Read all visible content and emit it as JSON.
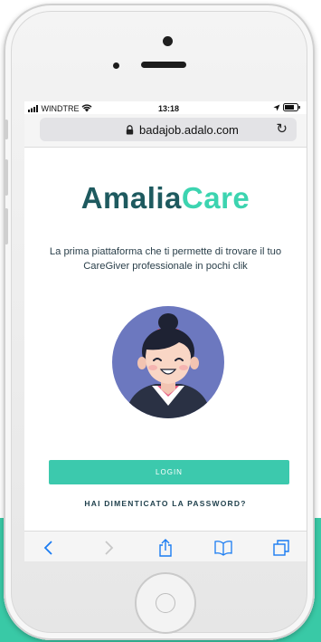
{
  "status_bar": {
    "carrier": "WINDTRE",
    "time": "13:18"
  },
  "browser": {
    "url": "badajob.adalo.com"
  },
  "app": {
    "brand_part1": "Amalia",
    "brand_part2": "Care",
    "tagline": "La prima piattaforma che ti permette di trovare il tuo CareGiver professionale in pochi clik",
    "login_label": "LOGIN",
    "forgot_password_label": "HAI DIMENTICATO LA PASSWORD?"
  },
  "colors": {
    "brand_dark": "#1e5a5f",
    "brand_accent": "#3cd4b0",
    "button": "#3cc9ad",
    "background_accent": "#39c9a6"
  },
  "icons": [
    "signal-icon",
    "wifi-icon",
    "location-arrow-icon",
    "battery-icon",
    "lock-icon",
    "reload-icon",
    "back-icon",
    "forward-icon",
    "share-icon",
    "bookmarks-icon",
    "tabs-icon"
  ]
}
